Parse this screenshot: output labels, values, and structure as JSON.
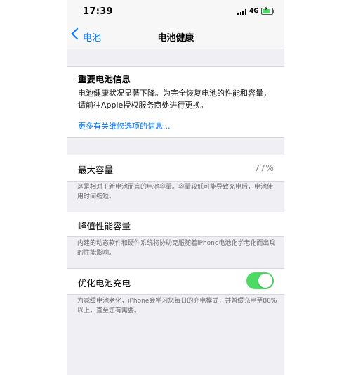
{
  "status_bar": {
    "time": "17:39",
    "network": "4G",
    "battery_level": 0.8,
    "battery_color": "#4cd964",
    "icons": [
      "signal-icon",
      "battery-icon",
      "charging-bolt-icon"
    ]
  },
  "nav": {
    "back_label": "电池",
    "title": "电池健康",
    "accent_color": "#007aff"
  },
  "info": {
    "title": "重要电池信息",
    "body": "电池健康状况显著下降。为完全恢复电池的性能和容量，请前往Apple授权服务商处进行更换。",
    "link": "更多有关维修选项的信息..."
  },
  "max_capacity": {
    "label": "最大容量",
    "value": "77%",
    "footer": "这是相对于新电池而言的电池容量。容量较低可能导致充电后，电池使用时间缩短。"
  },
  "peak_performance": {
    "label": "峰值性能容量",
    "footer": "内建的动态软件和硬件系统将协助克服随着iPhone电池化学老化而出现的性能影响。"
  },
  "optimized_charging": {
    "label": "优化电池充电",
    "enabled": true,
    "toggle_color": "#4cd964",
    "footer": "为减缓电池老化，iPhone会学习您每日的充电模式，并暂缓充电至80%以上，直至您有需要。"
  }
}
